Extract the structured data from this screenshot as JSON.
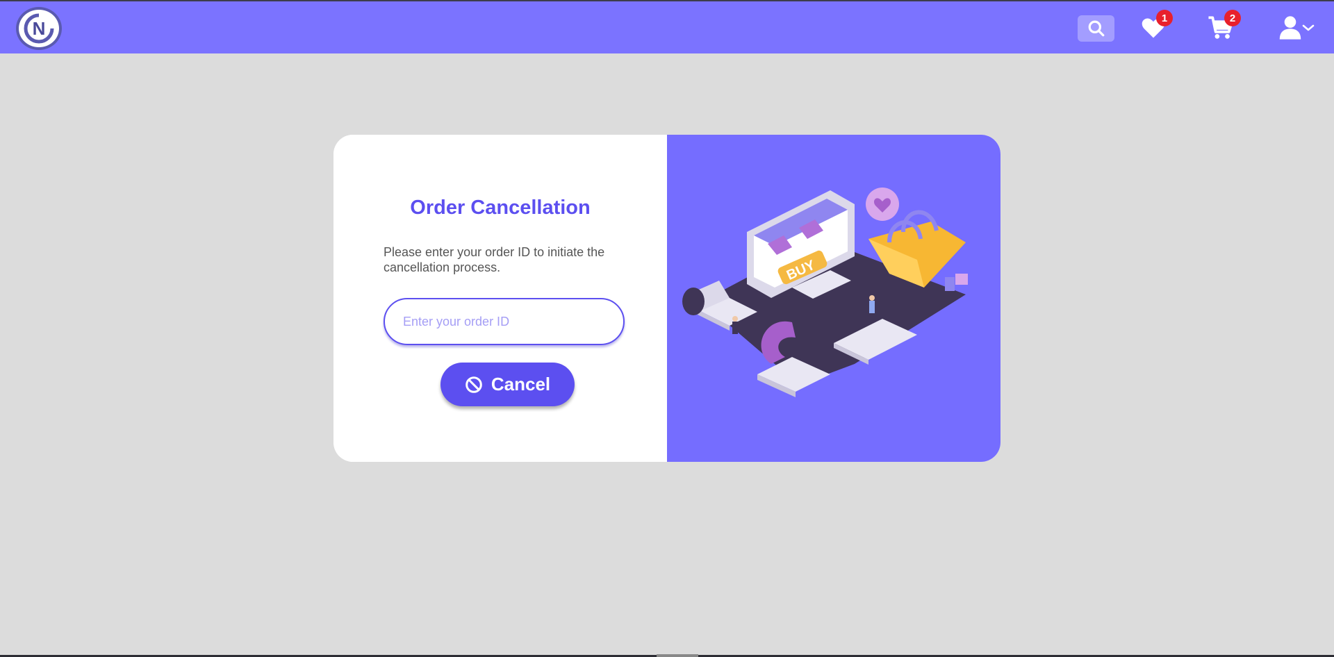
{
  "header": {
    "logo_letter": "N",
    "wishlist_count": "1",
    "cart_count": "2"
  },
  "form": {
    "title": "Order Cancellation",
    "description": "Please enter your order ID to initiate the cancellation process.",
    "order_id_placeholder": "Enter your order ID",
    "order_id_value": "",
    "cancel_label": "Cancel"
  },
  "illustration": {
    "sign_text": "BUY"
  },
  "colors": {
    "nav": "#7b73ff",
    "accent": "#5c4ff0",
    "illustration_bg": "#756dff",
    "page_bg": "#dcdcdc",
    "badge": "#e8202c"
  },
  "icons": [
    "logo-icon",
    "search-icon",
    "heart-icon",
    "cart-icon",
    "user-icon",
    "chevron-down-icon",
    "ban-icon"
  ]
}
